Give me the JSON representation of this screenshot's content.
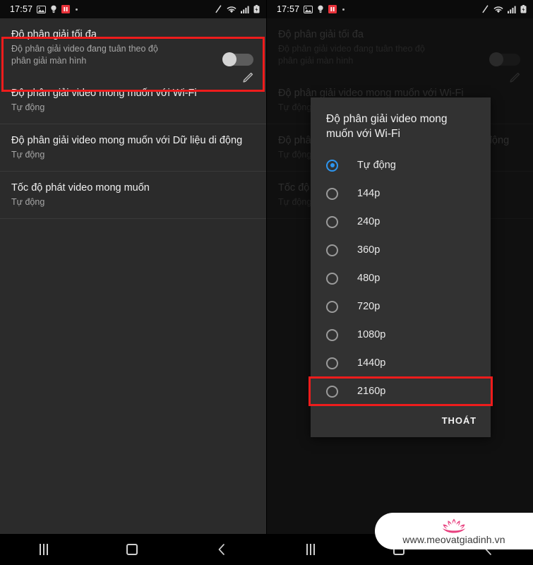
{
  "statusbar": {
    "time": "17:57",
    "left_icons": [
      "image-icon",
      "bulb-icon",
      "pause-badge-icon",
      "dot-icon"
    ],
    "right_icons": [
      "pencil-slash-icon",
      "wifi-icon",
      "signal-icon",
      "battery-icon"
    ]
  },
  "settings": {
    "rows": [
      {
        "title": "Độ phân giải tối đa",
        "subtitle": "Độ phân giải video đang tuân theo độ phân giải màn hình",
        "toggle": "off",
        "highlighted": true
      },
      {
        "title": "Độ phân giải video mong muốn với Wi-Fi",
        "subtitle": "Tự động",
        "highlighted": false
      },
      {
        "title": "Độ phân giải video mong muốn với Dữ liệu di động",
        "subtitle": "Tự động",
        "highlighted": false
      },
      {
        "title": "Tốc độ phát video mong muốn",
        "subtitle": "Tự động",
        "highlighted": false
      }
    ]
  },
  "dialog": {
    "title": "Độ phân giải video mong muốn với Wi-Fi",
    "options": [
      {
        "label": "Tự động",
        "selected": true,
        "highlighted": false
      },
      {
        "label": "144p",
        "selected": false,
        "highlighted": false
      },
      {
        "label": "240p",
        "selected": false,
        "highlighted": false
      },
      {
        "label": "360p",
        "selected": false,
        "highlighted": false
      },
      {
        "label": "480p",
        "selected": false,
        "highlighted": false
      },
      {
        "label": "720p",
        "selected": false,
        "highlighted": false
      },
      {
        "label": "1080p",
        "selected": false,
        "highlighted": false
      },
      {
        "label": "1440p",
        "selected": false,
        "highlighted": false
      },
      {
        "label": "2160p",
        "selected": false,
        "highlighted": true
      }
    ],
    "dismiss_label": "THOÁT"
  },
  "navbar": {
    "recents": "recents-icon",
    "home": "home-icon",
    "back": "back-icon"
  },
  "watermark": {
    "url": "www.meovatgiadinh.vn",
    "logo": "lotus-icon"
  },
  "colors": {
    "accent": "#2e96f0",
    "highlight": "#ee1c1c",
    "background": "#2b2b2b",
    "dialog": "#323232",
    "brand_pink": "#e8417f"
  }
}
